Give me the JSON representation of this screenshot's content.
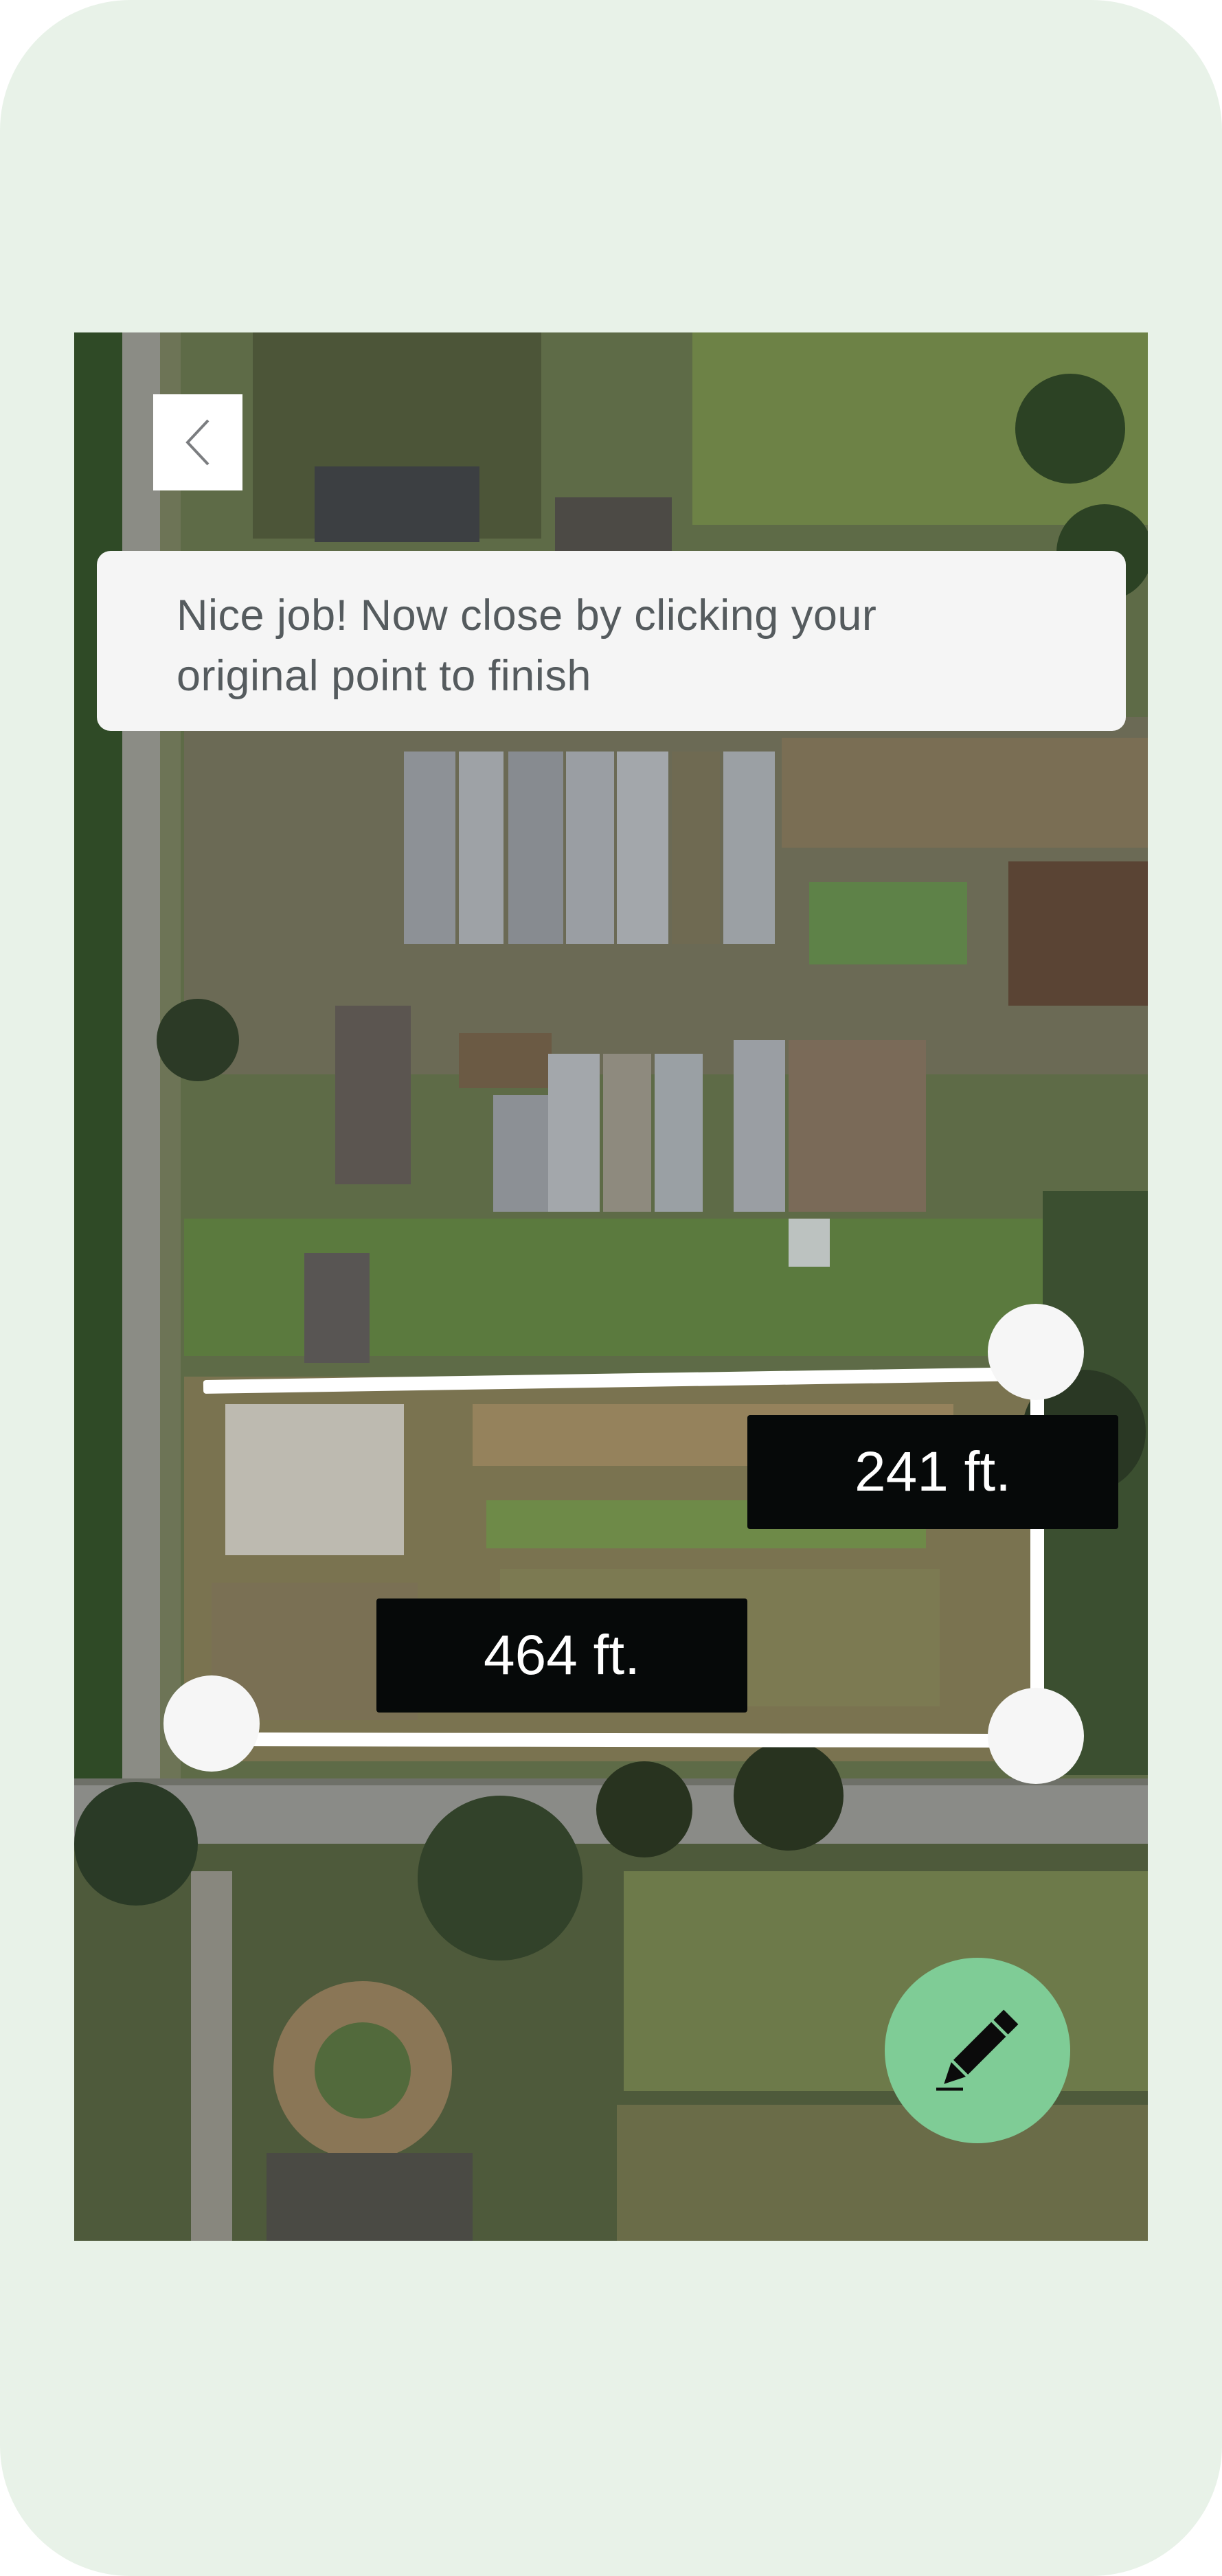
{
  "hint": {
    "text": "Nice job!  Now close by clicking your\noriginal point to finish"
  },
  "measurements": [
    {
      "label": "241 ft."
    },
    {
      "label": "464 ft."
    }
  ],
  "icons": {
    "back": "chevron-left-icon",
    "edit": "pencil-icon"
  },
  "colors": {
    "background": "#e8f2e8",
    "banner": "#f5f5f5",
    "label": "#060909",
    "fab": "#7fcc96",
    "line": "#ffffff"
  }
}
